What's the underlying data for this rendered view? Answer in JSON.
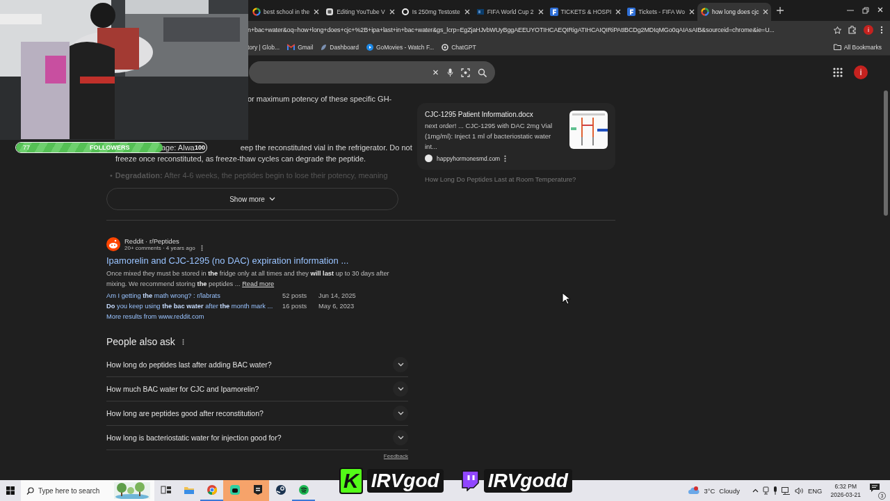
{
  "browser": {
    "tabs": [
      {
        "title": "best school in the",
        "selected": false
      },
      {
        "title": "Editing YouTube V",
        "selected": false
      },
      {
        "title": "Is 250mg Testoste",
        "selected": false
      },
      {
        "title": "FIFA World Cup 2",
        "selected": false
      },
      {
        "title": "TICKETS & HOSPI",
        "selected": false
      },
      {
        "title": "Tickets - FIFA Wo",
        "selected": false
      },
      {
        "title": "how long does cjc",
        "selected": true
      }
    ],
    "address": "n+bac+water&oq=how+long+does+cjc+%2B+ipa+last+in+bac+water&gs_lcrp=EgZjaHJvbWUyBggAEEUYOTIHCAEQIRigATIHCAIQIRiPAtIBCDg2MDIqMGo0qAIAsAIB&sourceid=chrome&ie=U...",
    "profile_initial": "i",
    "bookmarks": [
      {
        "label": "tory | Glob..."
      },
      {
        "label": "Gmail"
      },
      {
        "label": "Dashboard"
      },
      {
        "label": "GoMovies - Watch F..."
      },
      {
        "label": "ChatGPT"
      }
    ],
    "all_bookmarks": "All Bookmarks"
  },
  "search_header": {
    "profile_initial": "i"
  },
  "results": {
    "snippet": {
      "line_1": "or maximum potency of these specific GH-",
      "storage_start": "age: Alwa",
      "storage_rest": "eep the reconstituted vial in the refrigerator. Do not",
      "storage_line_2": "freeze once reconstituted, as freeze-thaw cycles can degrade the peptide.",
      "bullet": "•",
      "degradation": "**Degradation:** After 4-6 weeks, the peptides begin to lose their potency, meaning"
    },
    "show_more": "Show more",
    "reddit": {
      "source": "Reddit · r/Peptides",
      "meta": "20+ comments · 4 years ago",
      "title": "Ipamorelin and CJC-1295 (no DAC) expiration information ...",
      "snippet": "Once mixed they must be stored in **the** fridge only at all times and they **will last** up to 30 days after mixing. We recommend storing **the** peptides ...",
      "read_more": "Read more",
      "threads": [
        {
          "title": "Am I getting **the** math wrong? : r/labrats",
          "posts": "52 posts",
          "date": "Jun 14, 2025"
        },
        {
          "title": "**Do** you keep using **the bac water** after **the** month mark ...",
          "posts": "16 posts",
          "date": "May 6, 2023"
        }
      ],
      "more": "More results from www.reddit.com"
    },
    "people_also_ask": {
      "heading": "People also ask",
      "questions": [
        {
          "text": "How long do peptides last after adding BAC water?",
          "expanded": false
        },
        {
          "text": "How much BAC water for CJC and Ipamorelin?",
          "expanded": false
        },
        {
          "text": "How long are peptides good after reconstitution?",
          "expanded": false
        },
        {
          "text": "How long is bacteriostatic water for injection good for?",
          "expanded": false
        }
      ],
      "feedback": "Feedback"
    }
  },
  "side_card": {
    "title": "CJC-1295 Patient Information.docx",
    "snippet": "next order! ... CJC-1295 with DAC 2mg Vial (1mg/ml): Inject 1 ml of bacteriostatic water int...",
    "site": "happyhormonesmd.com",
    "next_title": "How Long Do Peptides Last at Room Temperature?"
  },
  "stream_overlay": {
    "followers": {
      "count": "77",
      "label": "FOLLOWERS",
      "goal": "100",
      "level": 0.77
    },
    "kick_mark": "K",
    "kick_name": "IRVgod",
    "twitch_name": "IRVgodd"
  },
  "taskbar": {
    "search_placeholder": "Type here to search",
    "apps": [
      {
        "kind": "task-view",
        "running": false,
        "flashing": false
      },
      {
        "kind": "folder",
        "running": false,
        "flashing": false
      },
      {
        "kind": "chrome",
        "running": true,
        "flashing": false
      },
      {
        "kind": "chat",
        "running": false,
        "flashing": true
      },
      {
        "kind": "epic",
        "running": false,
        "flashing": true
      },
      {
        "kind": "steam",
        "running": false,
        "flashing": false
      },
      {
        "kind": "spotify",
        "running": true,
        "flashing": false
      }
    ],
    "weather": {
      "temperature": "3°C",
      "condition": "Cloudy"
    },
    "language": "ENG",
    "time": "6:32 PM",
    "date": "2026-03-21",
    "notifications": "3"
  }
}
